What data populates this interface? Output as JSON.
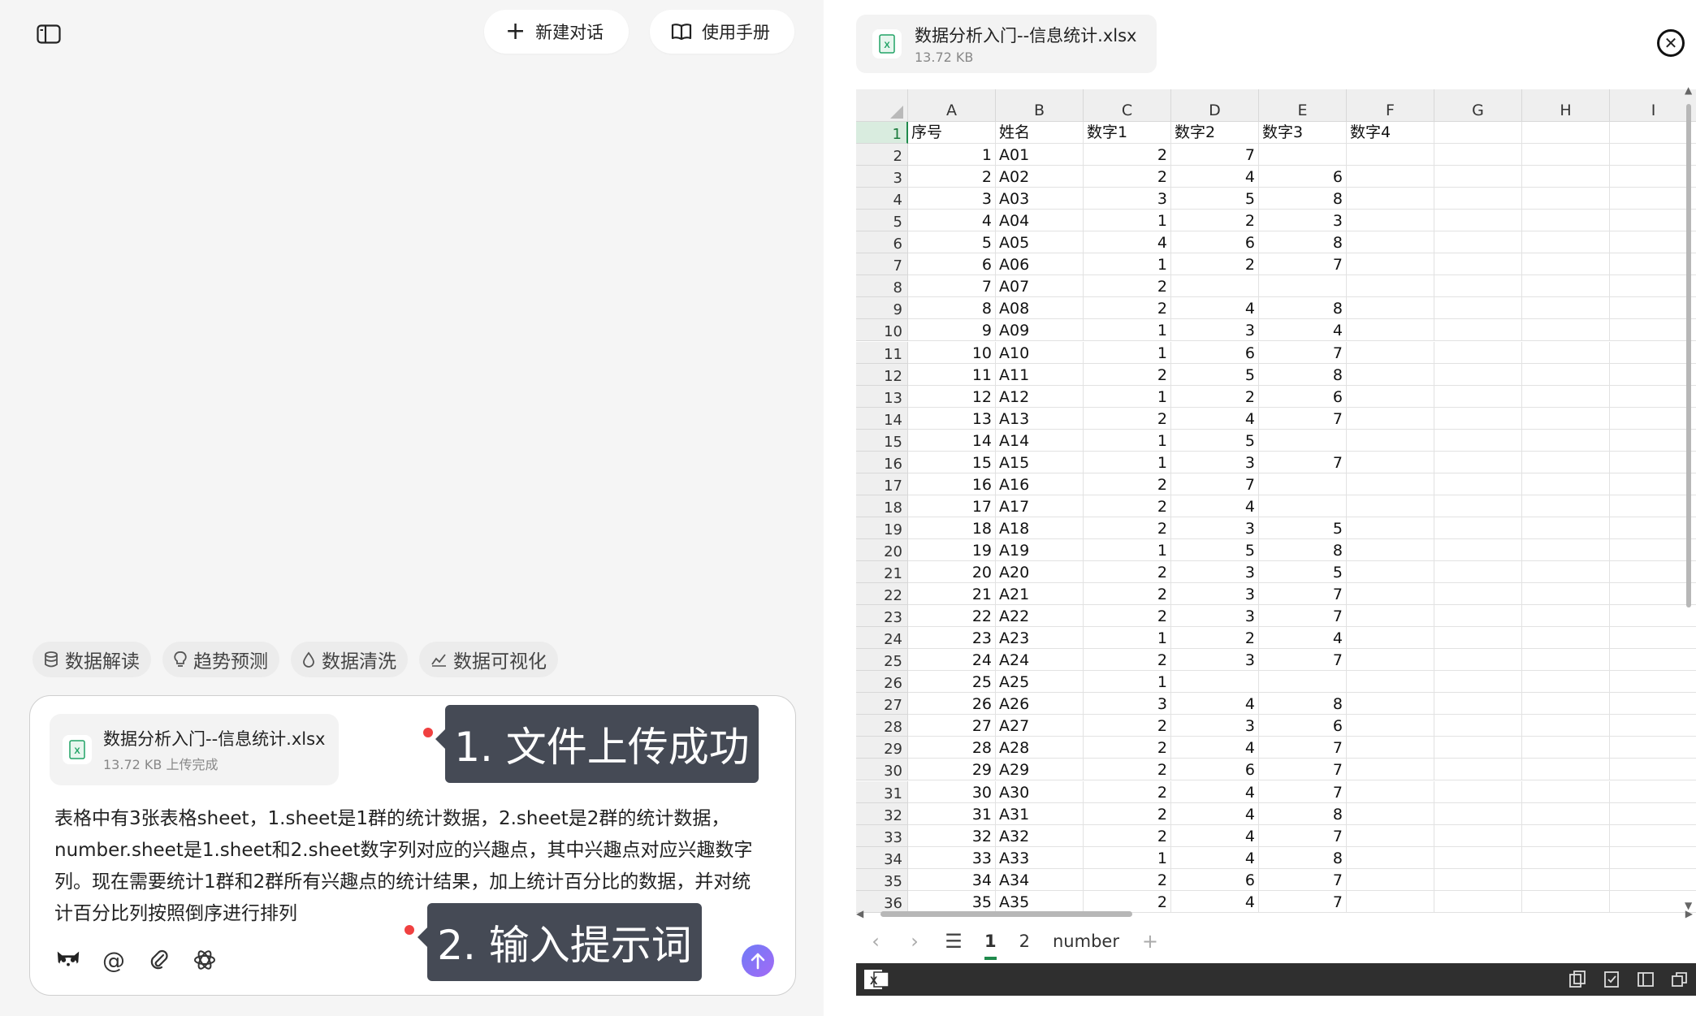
{
  "header": {
    "new_chat_label": "新建对话",
    "manual_label": "使用手册"
  },
  "chips": [
    {
      "label": "数据解读",
      "icon": "database-icon"
    },
    {
      "label": "趋势预测",
      "icon": "lightbulb-icon"
    },
    {
      "label": "数据清洗",
      "icon": "droplet-icon"
    },
    {
      "label": "数据可视化",
      "icon": "chart-line-icon"
    }
  ],
  "upload": {
    "file_name": "数据分析入门--信息统计.xlsx",
    "file_meta": "13.72 KB 上传完成"
  },
  "prompt_text": "表格中有3张表格sheet，1.sheet是1群的统计数据，2.sheet是2群的统计数据，number.sheet是1.sheet和2.sheet数字列对应的兴趣点，其中兴趣点对应兴趣数字列。现在需要统计1群和2群所有兴趣点的统计结果，加上统计百分比的数据，并对统计百分比列按照倒序进行排列",
  "callouts": {
    "step1": "1. 文件上传成功",
    "step2": "2. 输入提示词"
  },
  "viewer": {
    "file_name": "数据分析入门--信息统计.xlsx",
    "file_size": "13.72 KB"
  },
  "sheet": {
    "columns": [
      "A",
      "B",
      "C",
      "D",
      "E",
      "F",
      "G",
      "H",
      "I"
    ],
    "header_row": [
      "序号",
      "姓名",
      "数字1",
      "数字2",
      "数字3",
      "数字4"
    ],
    "rows": [
      [
        "1",
        "A01",
        "2",
        "7",
        ""
      ],
      [
        "2",
        "A02",
        "2",
        "4",
        "6"
      ],
      [
        "3",
        "A03",
        "3",
        "5",
        "8"
      ],
      [
        "4",
        "A04",
        "1",
        "2",
        "3"
      ],
      [
        "5",
        "A05",
        "4",
        "6",
        "8"
      ],
      [
        "6",
        "A06",
        "1",
        "2",
        "7"
      ],
      [
        "7",
        "A07",
        "2",
        "",
        ""
      ],
      [
        "8",
        "A08",
        "2",
        "4",
        "8"
      ],
      [
        "9",
        "A09",
        "1",
        "3",
        "4"
      ],
      [
        "10",
        "A10",
        "1",
        "6",
        "7"
      ],
      [
        "11",
        "A11",
        "2",
        "5",
        "8"
      ],
      [
        "12",
        "A12",
        "1",
        "2",
        "6"
      ],
      [
        "13",
        "A13",
        "2",
        "4",
        "7"
      ],
      [
        "14",
        "A14",
        "1",
        "5",
        ""
      ],
      [
        "15",
        "A15",
        "1",
        "3",
        "7"
      ],
      [
        "16",
        "A16",
        "2",
        "7",
        ""
      ],
      [
        "17",
        "A17",
        "2",
        "4",
        ""
      ],
      [
        "18",
        "A18",
        "2",
        "3",
        "5"
      ],
      [
        "19",
        "A19",
        "1",
        "5",
        "8"
      ],
      [
        "20",
        "A20",
        "2",
        "3",
        "5"
      ],
      [
        "21",
        "A21",
        "2",
        "3",
        "7"
      ],
      [
        "22",
        "A22",
        "2",
        "3",
        "7"
      ],
      [
        "23",
        "A23",
        "1",
        "2",
        "4"
      ],
      [
        "24",
        "A24",
        "2",
        "3",
        "7"
      ],
      [
        "25",
        "A25",
        "1",
        "",
        ""
      ],
      [
        "26",
        "A26",
        "3",
        "4",
        "8"
      ],
      [
        "27",
        "A27",
        "2",
        "3",
        "6"
      ],
      [
        "28",
        "A28",
        "2",
        "4",
        "7"
      ],
      [
        "29",
        "A29",
        "2",
        "6",
        "7"
      ],
      [
        "30",
        "A30",
        "2",
        "4",
        "7"
      ],
      [
        "31",
        "A31",
        "2",
        "4",
        "8"
      ],
      [
        "32",
        "A32",
        "2",
        "4",
        "7"
      ],
      [
        "33",
        "A33",
        "1",
        "4",
        "8"
      ],
      [
        "34",
        "A34",
        "2",
        "6",
        "7"
      ],
      [
        "35",
        "A35",
        "2",
        "4",
        "7"
      ]
    ]
  },
  "sheet_tabs": [
    "1",
    "2",
    "number"
  ],
  "active_tab": "1",
  "tab_add": "+"
}
